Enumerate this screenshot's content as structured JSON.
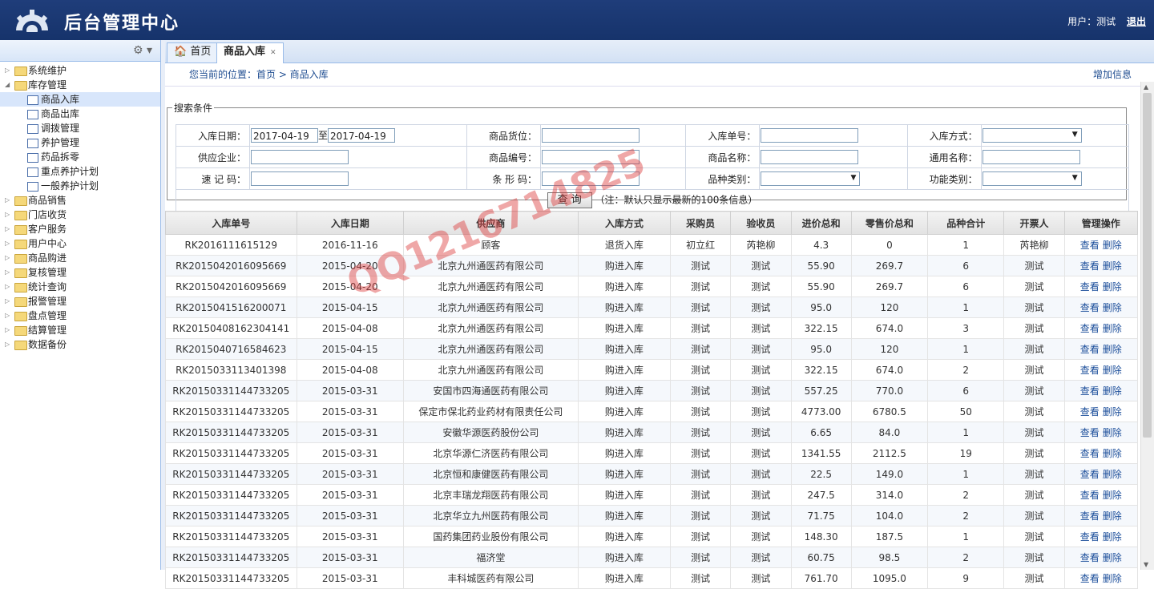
{
  "header": {
    "title": "后台管理中心",
    "user_label": "用户：",
    "user_name": "测试",
    "logout": "退出"
  },
  "sidebar": {
    "items": [
      {
        "label": "系统维护",
        "level": 0,
        "toggle": "▷"
      },
      {
        "label": "库存管理",
        "level": 0,
        "toggle": "◢"
      },
      {
        "label": "商品入库",
        "level": 1,
        "active": true
      },
      {
        "label": "商品出库",
        "level": 1
      },
      {
        "label": "调拨管理",
        "level": 1
      },
      {
        "label": "养护管理",
        "level": 1
      },
      {
        "label": "药品拆零",
        "level": 1
      },
      {
        "label": "重点养护计划",
        "level": 1
      },
      {
        "label": "一般养护计划",
        "level": 1
      },
      {
        "label": "商品销售",
        "level": 0,
        "toggle": "▷"
      },
      {
        "label": "门店收货",
        "level": 0,
        "toggle": "▷"
      },
      {
        "label": "客户服务",
        "level": 0,
        "toggle": "▷"
      },
      {
        "label": "用户中心",
        "level": 0,
        "toggle": "▷"
      },
      {
        "label": "商品购进",
        "level": 0,
        "toggle": "▷"
      },
      {
        "label": "复核管理",
        "level": 0,
        "toggle": "▷"
      },
      {
        "label": "统计查询",
        "level": 0,
        "toggle": "▷"
      },
      {
        "label": "报警管理",
        "level": 0,
        "toggle": "▷"
      },
      {
        "label": "盘点管理",
        "level": 0,
        "toggle": "▷"
      },
      {
        "label": "结算管理",
        "level": 0,
        "toggle": "▷"
      },
      {
        "label": "数据备份",
        "level": 0,
        "toggle": "▷"
      }
    ]
  },
  "tabs": [
    {
      "label": "首页"
    },
    {
      "label": "商品入库"
    }
  ],
  "breadcrumb": {
    "text": "您当前的位置：首页 > 商品入库",
    "add": "增加信息"
  },
  "search": {
    "legend": "搜索条件",
    "date_label": "入库日期：",
    "date_from": "2017-04-19",
    "date_to_sep": "至",
    "date_to": "2017-04-19",
    "loc_label": "商品货位：",
    "no_label": "入库单号：",
    "method_label": "入库方式：",
    "supplier_label": "供应企业：",
    "code_label": "商品编号：",
    "name_label": "商品名称：",
    "generic_label": "通用名称：",
    "quick_label": "速 记 码：",
    "barcode_label": "条 形 码：",
    "kind_label": "品种类别：",
    "func_label": "功能类别：",
    "query_btn": "查 询",
    "note": "（注：默认只显示最新的100条信息）"
  },
  "grid": {
    "columns": [
      "入库单号",
      "入库日期",
      "供应商",
      "入库方式",
      "采购员",
      "验收员",
      "进价总和",
      "零售价总和",
      "品种合计",
      "开票人",
      "管理操作"
    ],
    "view": "查看",
    "del": "删除",
    "rows": [
      [
        "RK2016111615129",
        "2016-11-16",
        "顾客",
        "退货入库",
        "初立红",
        "芮艳柳",
        "4.3",
        "0",
        "1",
        "芮艳柳"
      ],
      [
        "RK2015042016095669",
        "2015-04-20",
        "北京九州通医药有限公司",
        "购进入库",
        "测试",
        "测试",
        "55.90",
        "269.7",
        "6",
        "测试"
      ],
      [
        "RK2015042016095669",
        "2015-04-20",
        "北京九州通医药有限公司",
        "购进入库",
        "测试",
        "测试",
        "55.90",
        "269.7",
        "6",
        "测试"
      ],
      [
        "RK2015041516200071",
        "2015-04-15",
        "北京九州通医药有限公司",
        "购进入库",
        "测试",
        "测试",
        "95.0",
        "120",
        "1",
        "测试"
      ],
      [
        "RK20150408162304141",
        "2015-04-08",
        "北京九州通医药有限公司",
        "购进入库",
        "测试",
        "测试",
        "322.15",
        "674.0",
        "3",
        "测试"
      ],
      [
        "RK2015040716584623",
        "2015-04-15",
        "北京九州通医药有限公司",
        "购进入库",
        "测试",
        "测试",
        "95.0",
        "120",
        "1",
        "测试"
      ],
      [
        "RK2015033113401398",
        "2015-04-08",
        "北京九州通医药有限公司",
        "购进入库",
        "测试",
        "测试",
        "322.15",
        "674.0",
        "2",
        "测试"
      ],
      [
        "RK20150331144733205",
        "2015-03-31",
        "安国市四海通医药有限公司",
        "购进入库",
        "测试",
        "测试",
        "557.25",
        "770.0",
        "6",
        "测试"
      ],
      [
        "RK20150331144733205",
        "2015-03-31",
        "保定市保北药业药材有限责任公司",
        "购进入库",
        "测试",
        "测试",
        "4773.00",
        "6780.5",
        "50",
        "测试"
      ],
      [
        "RK20150331144733205",
        "2015-03-31",
        "安徽华源医药股份公司",
        "购进入库",
        "测试",
        "测试",
        "6.65",
        "84.0",
        "1",
        "测试"
      ],
      [
        "RK20150331144733205",
        "2015-03-31",
        "北京华源仁济医药有限公司",
        "购进入库",
        "测试",
        "测试",
        "1341.55",
        "2112.5",
        "19",
        "测试"
      ],
      [
        "RK20150331144733205",
        "2015-03-31",
        "北京恒和康健医药有限公司",
        "购进入库",
        "测试",
        "测试",
        "22.5",
        "149.0",
        "1",
        "测试"
      ],
      [
        "RK20150331144733205",
        "2015-03-31",
        "北京丰瑞龙翔医药有限公司",
        "购进入库",
        "测试",
        "测试",
        "247.5",
        "314.0",
        "2",
        "测试"
      ],
      [
        "RK20150331144733205",
        "2015-03-31",
        "北京华立九州医药有限公司",
        "购进入库",
        "测试",
        "测试",
        "71.75",
        "104.0",
        "2",
        "测试"
      ],
      [
        "RK20150331144733205",
        "2015-03-31",
        "国药集团药业股份有限公司",
        "购进入库",
        "测试",
        "测试",
        "148.30",
        "187.5",
        "1",
        "测试"
      ],
      [
        "RK20150331144733205",
        "2015-03-31",
        "福济堂",
        "购进入库",
        "测试",
        "测试",
        "60.75",
        "98.5",
        "2",
        "测试"
      ],
      [
        "RK20150331144733205",
        "2015-03-31",
        "丰科城医药有限公司",
        "购进入库",
        "测试",
        "测试",
        "761.70",
        "1095.0",
        "9",
        "测试"
      ]
    ]
  },
  "watermark": "QQ1216714825"
}
